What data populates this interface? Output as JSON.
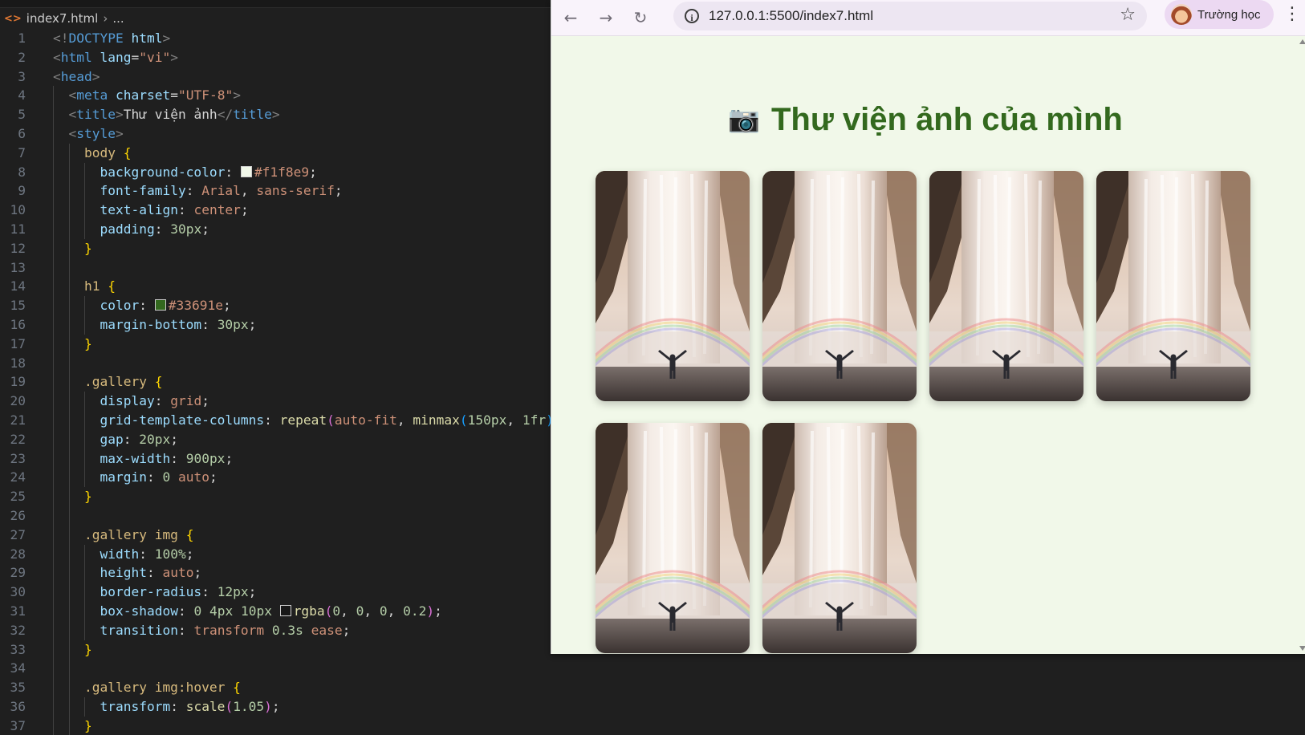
{
  "editor": {
    "breadcrumb": {
      "file": "index7.html",
      "more": "..."
    },
    "lines": [
      {
        "n": "1",
        "guides": 0,
        "tokens": [
          [
            "t-br",
            "<!"
          ],
          [
            "t-tag",
            "DOCTYPE"
          ],
          [
            "t-txt",
            " "
          ],
          [
            "t-attr",
            "html"
          ],
          [
            "t-br",
            ">"
          ]
        ]
      },
      {
        "n": "2",
        "guides": 0,
        "tokens": [
          [
            "t-br",
            "<"
          ],
          [
            "t-tag",
            "html"
          ],
          [
            "t-txt",
            " "
          ],
          [
            "t-attr",
            "lang"
          ],
          [
            "t-txt",
            "="
          ],
          [
            "t-str",
            "\"vi\""
          ],
          [
            "t-br",
            ">"
          ]
        ]
      },
      {
        "n": "3",
        "guides": 0,
        "tokens": [
          [
            "t-br",
            "<"
          ],
          [
            "t-tag",
            "head"
          ],
          [
            "t-br",
            ">"
          ]
        ]
      },
      {
        "n": "4",
        "guides": 1,
        "tokens": [
          [
            "t-txt",
            "  "
          ],
          [
            "t-br",
            "<"
          ],
          [
            "t-tag",
            "meta"
          ],
          [
            "t-txt",
            " "
          ],
          [
            "t-attr",
            "charset"
          ],
          [
            "t-txt",
            "="
          ],
          [
            "t-str",
            "\"UTF-8\""
          ],
          [
            "t-br",
            ">"
          ]
        ]
      },
      {
        "n": "5",
        "guides": 1,
        "tokens": [
          [
            "t-txt",
            "  "
          ],
          [
            "t-br",
            "<"
          ],
          [
            "t-tag",
            "title"
          ],
          [
            "t-br",
            ">"
          ],
          [
            "t-txt",
            "Thư viện ảnh"
          ],
          [
            "t-br",
            "</"
          ],
          [
            "t-tag",
            "title"
          ],
          [
            "t-br",
            ">"
          ]
        ]
      },
      {
        "n": "6",
        "guides": 1,
        "tokens": [
          [
            "t-txt",
            "  "
          ],
          [
            "t-br",
            "<"
          ],
          [
            "t-tag",
            "style"
          ],
          [
            "t-br",
            ">"
          ]
        ]
      },
      {
        "n": "7",
        "guides": 2,
        "tokens": [
          [
            "t-txt",
            "    "
          ],
          [
            "t-sel",
            "body"
          ],
          [
            "t-txt",
            " "
          ],
          [
            "t-p1",
            "{"
          ]
        ]
      },
      {
        "n": "8",
        "guides": 3,
        "tokens": [
          [
            "t-txt",
            "      "
          ],
          [
            "t-prop",
            "background-color"
          ],
          [
            "t-txt",
            ": "
          ],
          [
            "swatch",
            "#f1f8e9"
          ],
          [
            "t-val",
            "#f1f8e9"
          ],
          [
            "t-txt",
            ";"
          ]
        ]
      },
      {
        "n": "9",
        "guides": 3,
        "tokens": [
          [
            "t-txt",
            "      "
          ],
          [
            "t-prop",
            "font-family"
          ],
          [
            "t-txt",
            ": "
          ],
          [
            "t-val",
            "Arial"
          ],
          [
            "t-txt",
            ", "
          ],
          [
            "t-val",
            "sans-serif"
          ],
          [
            "t-txt",
            ";"
          ]
        ]
      },
      {
        "n": "10",
        "guides": 3,
        "tokens": [
          [
            "t-txt",
            "      "
          ],
          [
            "t-prop",
            "text-align"
          ],
          [
            "t-txt",
            ": "
          ],
          [
            "t-val",
            "center"
          ],
          [
            "t-txt",
            ";"
          ]
        ]
      },
      {
        "n": "11",
        "guides": 3,
        "tokens": [
          [
            "t-txt",
            "      "
          ],
          [
            "t-prop",
            "padding"
          ],
          [
            "t-txt",
            ": "
          ],
          [
            "t-num",
            "30px"
          ],
          [
            "t-txt",
            ";"
          ]
        ]
      },
      {
        "n": "12",
        "guides": 2,
        "tokens": [
          [
            "t-txt",
            "    "
          ],
          [
            "t-p1",
            "}"
          ]
        ]
      },
      {
        "n": "13",
        "guides": 2,
        "tokens": []
      },
      {
        "n": "14",
        "guides": 2,
        "tokens": [
          [
            "t-txt",
            "    "
          ],
          [
            "t-sel",
            "h1"
          ],
          [
            "t-txt",
            " "
          ],
          [
            "t-p1",
            "{"
          ]
        ]
      },
      {
        "n": "15",
        "guides": 3,
        "tokens": [
          [
            "t-txt",
            "      "
          ],
          [
            "t-prop",
            "color"
          ],
          [
            "t-txt",
            ": "
          ],
          [
            "swatch",
            "#33691e"
          ],
          [
            "t-val",
            "#33691e"
          ],
          [
            "t-txt",
            ";"
          ]
        ]
      },
      {
        "n": "16",
        "guides": 3,
        "tokens": [
          [
            "t-txt",
            "      "
          ],
          [
            "t-prop",
            "margin-bottom"
          ],
          [
            "t-txt",
            ": "
          ],
          [
            "t-num",
            "30px"
          ],
          [
            "t-txt",
            ";"
          ]
        ]
      },
      {
        "n": "17",
        "guides": 2,
        "tokens": [
          [
            "t-txt",
            "    "
          ],
          [
            "t-p1",
            "}"
          ]
        ]
      },
      {
        "n": "18",
        "guides": 2,
        "tokens": []
      },
      {
        "n": "19",
        "guides": 2,
        "tokens": [
          [
            "t-txt",
            "    "
          ],
          [
            "t-sel",
            ".gallery"
          ],
          [
            "t-txt",
            " "
          ],
          [
            "t-p1",
            "{"
          ]
        ]
      },
      {
        "n": "20",
        "guides": 3,
        "tokens": [
          [
            "t-txt",
            "      "
          ],
          [
            "t-prop",
            "display"
          ],
          [
            "t-txt",
            ": "
          ],
          [
            "t-val",
            "grid"
          ],
          [
            "t-txt",
            ";"
          ]
        ]
      },
      {
        "n": "21",
        "guides": 3,
        "tokens": [
          [
            "t-txt",
            "      "
          ],
          [
            "t-prop",
            "grid-template-columns"
          ],
          [
            "t-txt",
            ": "
          ],
          [
            "t-fn",
            "repeat"
          ],
          [
            "t-p2",
            "("
          ],
          [
            "t-val",
            "auto-fit"
          ],
          [
            "t-txt",
            ", "
          ],
          [
            "t-fn",
            "minmax"
          ],
          [
            "t-p3",
            "("
          ],
          [
            "t-num",
            "150px"
          ],
          [
            "t-txt",
            ", "
          ],
          [
            "t-num",
            "1fr"
          ],
          [
            "t-p3",
            ")"
          ],
          [
            "t-p2",
            ")"
          ]
        ]
      },
      {
        "n": "22",
        "guides": 3,
        "tokens": [
          [
            "t-txt",
            "      "
          ],
          [
            "t-prop",
            "gap"
          ],
          [
            "t-txt",
            ": "
          ],
          [
            "t-num",
            "20px"
          ],
          [
            "t-txt",
            ";"
          ]
        ]
      },
      {
        "n": "23",
        "guides": 3,
        "tokens": [
          [
            "t-txt",
            "      "
          ],
          [
            "t-prop",
            "max-width"
          ],
          [
            "t-txt",
            ": "
          ],
          [
            "t-num",
            "900px"
          ],
          [
            "t-txt",
            ";"
          ]
        ]
      },
      {
        "n": "24",
        "guides": 3,
        "tokens": [
          [
            "t-txt",
            "      "
          ],
          [
            "t-prop",
            "margin"
          ],
          [
            "t-txt",
            ": "
          ],
          [
            "t-num",
            "0"
          ],
          [
            "t-txt",
            " "
          ],
          [
            "t-val",
            "auto"
          ],
          [
            "t-txt",
            ";"
          ]
        ]
      },
      {
        "n": "25",
        "guides": 2,
        "tokens": [
          [
            "t-txt",
            "    "
          ],
          [
            "t-p1",
            "}"
          ]
        ]
      },
      {
        "n": "26",
        "guides": 2,
        "tokens": []
      },
      {
        "n": "27",
        "guides": 2,
        "tokens": [
          [
            "t-txt",
            "    "
          ],
          [
            "t-sel",
            ".gallery img"
          ],
          [
            "t-txt",
            " "
          ],
          [
            "t-p1",
            "{"
          ]
        ]
      },
      {
        "n": "28",
        "guides": 3,
        "tokens": [
          [
            "t-txt",
            "      "
          ],
          [
            "t-prop",
            "width"
          ],
          [
            "t-txt",
            ": "
          ],
          [
            "t-num",
            "100%"
          ],
          [
            "t-txt",
            ";"
          ]
        ]
      },
      {
        "n": "29",
        "guides": 3,
        "tokens": [
          [
            "t-txt",
            "      "
          ],
          [
            "t-prop",
            "height"
          ],
          [
            "t-txt",
            ": "
          ],
          [
            "t-val",
            "auto"
          ],
          [
            "t-txt",
            ";"
          ]
        ]
      },
      {
        "n": "30",
        "guides": 3,
        "tokens": [
          [
            "t-txt",
            "      "
          ],
          [
            "t-prop",
            "border-radius"
          ],
          [
            "t-txt",
            ": "
          ],
          [
            "t-num",
            "12px"
          ],
          [
            "t-txt",
            ";"
          ]
        ]
      },
      {
        "n": "31",
        "guides": 3,
        "tokens": [
          [
            "t-txt",
            "      "
          ],
          [
            "t-prop",
            "box-shadow"
          ],
          [
            "t-txt",
            ": "
          ],
          [
            "t-num",
            "0"
          ],
          [
            "t-txt",
            " "
          ],
          [
            "t-num",
            "4px"
          ],
          [
            "t-txt",
            " "
          ],
          [
            "t-num",
            "10px"
          ],
          [
            "t-txt",
            " "
          ],
          [
            "swatch",
            "rgba(0,0,0,0.2)"
          ],
          [
            "t-fn",
            "rgba"
          ],
          [
            "t-p2",
            "("
          ],
          [
            "t-num",
            "0"
          ],
          [
            "t-txt",
            ", "
          ],
          [
            "t-num",
            "0"
          ],
          [
            "t-txt",
            ", "
          ],
          [
            "t-num",
            "0"
          ],
          [
            "t-txt",
            ", "
          ],
          [
            "t-num",
            "0.2"
          ],
          [
            "t-p2",
            ")"
          ],
          [
            "t-txt",
            ";"
          ]
        ]
      },
      {
        "n": "32",
        "guides": 3,
        "tokens": [
          [
            "t-txt",
            "      "
          ],
          [
            "t-prop",
            "transition"
          ],
          [
            "t-txt",
            ": "
          ],
          [
            "t-val",
            "transform"
          ],
          [
            "t-txt",
            " "
          ],
          [
            "t-num",
            "0.3s"
          ],
          [
            "t-txt",
            " "
          ],
          [
            "t-val",
            "ease"
          ],
          [
            "t-txt",
            ";"
          ]
        ]
      },
      {
        "n": "33",
        "guides": 2,
        "tokens": [
          [
            "t-txt",
            "    "
          ],
          [
            "t-p1",
            "}"
          ]
        ]
      },
      {
        "n": "34",
        "guides": 2,
        "tokens": []
      },
      {
        "n": "35",
        "guides": 2,
        "tokens": [
          [
            "t-txt",
            "    "
          ],
          [
            "t-sel",
            ".gallery img:hover"
          ],
          [
            "t-txt",
            " "
          ],
          [
            "t-p1",
            "{"
          ]
        ]
      },
      {
        "n": "36",
        "guides": 3,
        "tokens": [
          [
            "t-txt",
            "      "
          ],
          [
            "t-prop",
            "transform"
          ],
          [
            "t-txt",
            ": "
          ],
          [
            "t-fn",
            "scale"
          ],
          [
            "t-p2",
            "("
          ],
          [
            "t-num",
            "1.05"
          ],
          [
            "t-p2",
            ")"
          ],
          [
            "t-txt",
            ";"
          ]
        ]
      },
      {
        "n": "37",
        "guides": 2,
        "tokens": [
          [
            "t-txt",
            "    "
          ],
          [
            "t-p1",
            "}"
          ]
        ]
      }
    ]
  },
  "browser": {
    "url": "127.0.0.1:5500/index7.html",
    "profile_label": "Trường học",
    "back_icon": "←",
    "forward_icon": "→",
    "reload_icon": "↻",
    "star_icon": "☆",
    "menu_icon": "⋮",
    "page": {
      "title": "Thư viện ảnh của mình",
      "camera_icon": "📷",
      "background": "#f1f8e9",
      "title_color": "#33691e",
      "photos": [
        {
          "subject": "waterfall-rainbow"
        },
        {
          "subject": "waterfall-rainbow"
        },
        {
          "subject": "waterfall-rainbow"
        },
        {
          "subject": "waterfall-rainbow"
        },
        {
          "subject": "waterfall-rainbow"
        },
        {
          "subject": "waterfall-rainbow"
        }
      ]
    }
  }
}
